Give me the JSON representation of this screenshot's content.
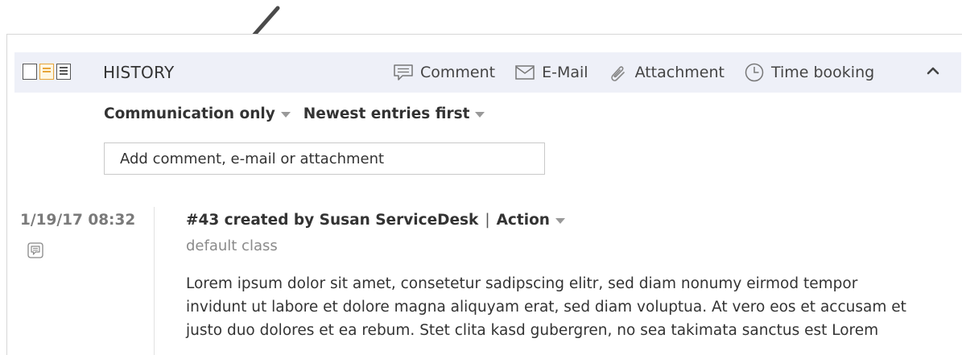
{
  "header": {
    "title": "HISTORY",
    "actions": [
      {
        "label": "Comment",
        "icon": "comment-icon"
      },
      {
        "label": "E-Mail",
        "icon": "mail-icon"
      },
      {
        "label": "Attachment",
        "icon": "paperclip-icon"
      },
      {
        "label": "Time booking",
        "icon": "clock-icon"
      }
    ],
    "view_icons": [
      "view-single-icon",
      "view-split-icon",
      "view-list-icon"
    ],
    "active_view": "view-split-icon",
    "collapse_icon": "chevron-up-icon"
  },
  "filters": {
    "type": "Communication only",
    "order": "Newest entries first"
  },
  "add_comment": {
    "placeholder": "Add comment, e-mail or attachment"
  },
  "entries": [
    {
      "timestamp": "1/19/17 08:32",
      "type_icon": "comment-icon",
      "title": "#43 created by Susan ServiceDesk",
      "action_label": "Action",
      "class_label": "default class",
      "body_lines": [
        "Lorem ipsum dolor sit amet, consetetur sadipscing elitr, sed diam nonumy eirmod tempor",
        "invidunt ut labore et dolore magna aliquyam erat, sed diam voluptua. At vero eos et accusam et",
        "justo duo dolores et ea rebum. Stet clita kasd gubergren, no sea takimata sanctus est Lorem"
      ]
    }
  ],
  "colors": {
    "header_bg": "#eef0f8",
    "active_view": "#e7a53a",
    "text": "#333333",
    "muted": "#8a8a8a",
    "annotation_arrow": "#4a4a4a"
  }
}
